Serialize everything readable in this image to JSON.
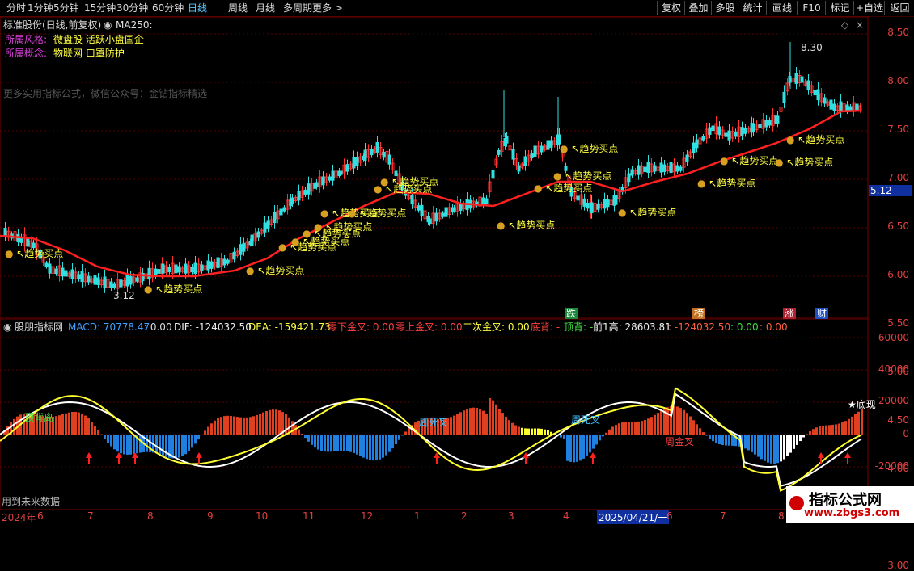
{
  "toolbar": {
    "left_items": [
      "分时",
      "1分钟",
      "5分钟",
      "15分钟",
      "30分钟",
      "60分钟",
      "日线",
      "周线",
      "月线",
      "多周期",
      "更多 >"
    ],
    "active_index": 6,
    "right_items": [
      "复权",
      "叠加",
      "多股",
      "统计",
      "画线",
      "F10",
      "标记",
      "+自选",
      "返回"
    ]
  },
  "main_chart": {
    "title": "标准股份(日线,前复权)",
    "ma_label": "MA250:",
    "style_label": "所属风格:",
    "style_value": "微盘股 活跃小盘国企",
    "concept_label": "所属概念:",
    "concept_value": "物联网 口罩防护",
    "watermark": "更多实用指标公式，微信公众号：金钻指标精选",
    "high_label": "8.30",
    "low_label": "3.12",
    "price_tag": "5.12",
    "signal_label": "趋势买点",
    "y_ticks": [
      "8.50",
      "8.00",
      "7.50",
      "7.00",
      "6.50",
      "6.00",
      "5.50",
      "5.00",
      "4.50",
      "4.00",
      "3.50",
      "3.00"
    ],
    "event_markers": [
      {
        "text": "跌",
        "color": "#1a8a3a"
      },
      {
        "text": "榜",
        "color": "#c07020"
      },
      {
        "text": "涨",
        "color": "#b02030"
      },
      {
        "text": "财",
        "color": "#2050c0"
      }
    ]
  },
  "indicator": {
    "name": "股朋指标网",
    "macd_label": "MACD: 70778.47",
    "macd_extra": ": 0.00",
    "dif": "DIF: -124032.50",
    "dea": "DEA: -159421.73",
    "cross_down": "零下金叉: 0.00",
    "cross_up": "零上金叉: 0.00",
    "second_cross": "二次金叉: 0.00",
    "bottom_div": "底背: -",
    "top_div": "顶背: -",
    "prev_high": "前1高: 28603.81",
    "val1": ": -124032.50",
    "val2": ": 0.00",
    "val3": ": 0.00",
    "y_ticks": [
      "60000",
      "40000",
      "20000",
      "0",
      "-20000"
    ],
    "notes": {
      "top_div_label": "顶背离",
      "weekly_dead1": "周死叉",
      "weekly_dead2": "周死叉",
      "weekly_gold": "周金叉",
      "bottom_label": "★底现"
    },
    "footer_note": "用到未来数据"
  },
  "x_axis": {
    "labels": [
      "2024年",
      "6",
      "7",
      "8",
      "9",
      "10",
      "11",
      "12",
      "1",
      "2",
      "3",
      "4",
      "2025/04/21/一",
      "6",
      "7",
      "8"
    ]
  },
  "brand": {
    "title": "指标公式网",
    "url": "www.zbgs3.com"
  }
}
